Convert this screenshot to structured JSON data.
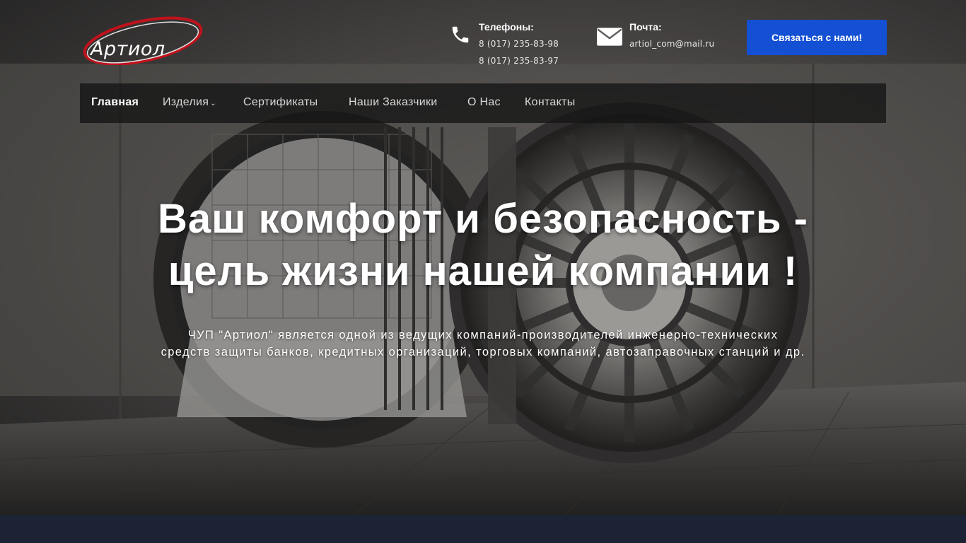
{
  "header": {
    "logo_text": "Артиол",
    "phones": {
      "title": "Телефоны:",
      "lines": [
        "8 (017) 235-83-98",
        "8 (017) 235-83-97"
      ]
    },
    "mail": {
      "title": "Почта:",
      "lines": [
        "artiol_com@mail.ru"
      ]
    },
    "cta_label": "Связаться с нами!"
  },
  "nav": {
    "items": [
      {
        "label": "Главная",
        "active": true
      },
      {
        "label": "Изделия",
        "dropdown": true
      },
      {
        "label": "Сертификаты"
      },
      {
        "label": "Наши Заказчики"
      },
      {
        "label": "О Нас"
      },
      {
        "label": "Контакты"
      }
    ]
  },
  "hero": {
    "headline_lines": [
      "Ваш комфорт и безопасность -",
      "цель жизни нашей компании !"
    ],
    "subtext_lines": [
      "ЧУП \"Артиол\" является одной из ведущих компаний-производителей инженерно-технических",
      "средств защиты банков, кредитных организаций, торговых компаний, автозаправочных станций и др."
    ]
  },
  "colors": {
    "cta": "#1450d4",
    "logo_swoosh": "#c0121c",
    "footer": "#1c2334",
    "navbar": "#141414"
  },
  "icons": {
    "phone": "phone-icon",
    "mail": "mail-icon",
    "dropdown": "chevron-down-icon"
  }
}
